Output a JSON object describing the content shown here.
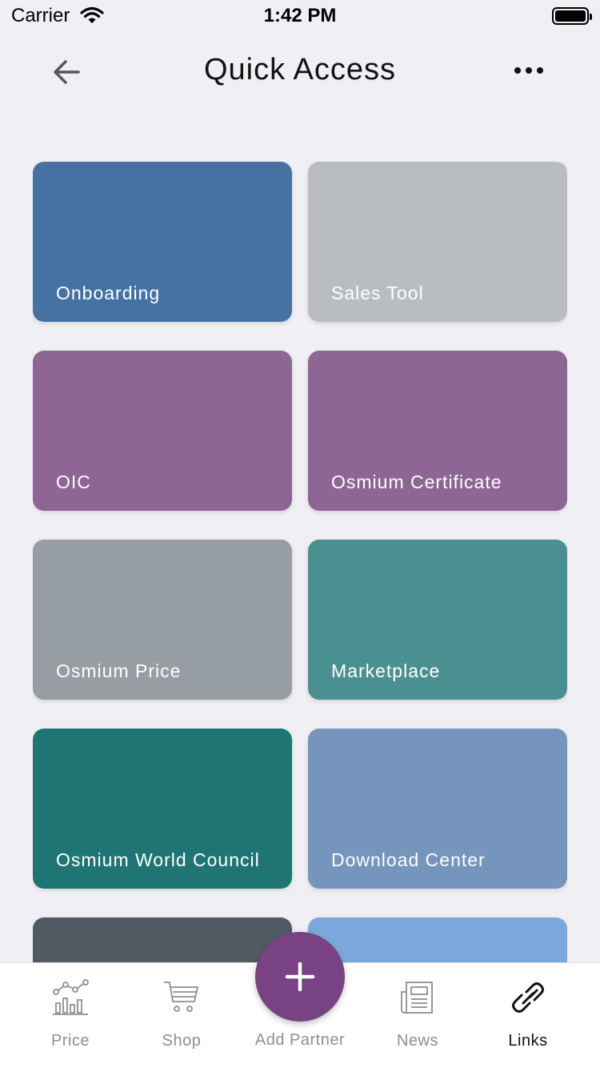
{
  "status_bar": {
    "carrier": "Carrier",
    "time": "1:42 PM",
    "wifi_icon": "wifi-icon",
    "battery_icon": "battery-icon"
  },
  "nav": {
    "title": "Quick Access",
    "back_icon": "arrow-left-icon",
    "more_icon": "more-horizontal-icon"
  },
  "tiles": [
    {
      "label": "Onboarding",
      "color": "#4672a3"
    },
    {
      "label": "Sales Tool",
      "color": "#b9bdc1"
    },
    {
      "label": "OIC",
      "color": "#8d6693"
    },
    {
      "label": "Osmium Certificate",
      "color": "#8d6693"
    },
    {
      "label": "Osmium Price",
      "color": "#969ea3"
    },
    {
      "label": "Marketplace",
      "color": "#4b9090"
    },
    {
      "label": "Osmium World Council",
      "color": "#1e7573"
    },
    {
      "label": "Download Center",
      "color": "#7595bc"
    },
    {
      "label": "",
      "color": "#505a63"
    },
    {
      "label": "",
      "color": "#7aa8dd"
    }
  ],
  "tab_bar": {
    "price": "Price",
    "shop": "Shop",
    "add_partner": "Add Partner",
    "news": "News",
    "links": "Links",
    "active": "links",
    "accent": "#784283"
  }
}
